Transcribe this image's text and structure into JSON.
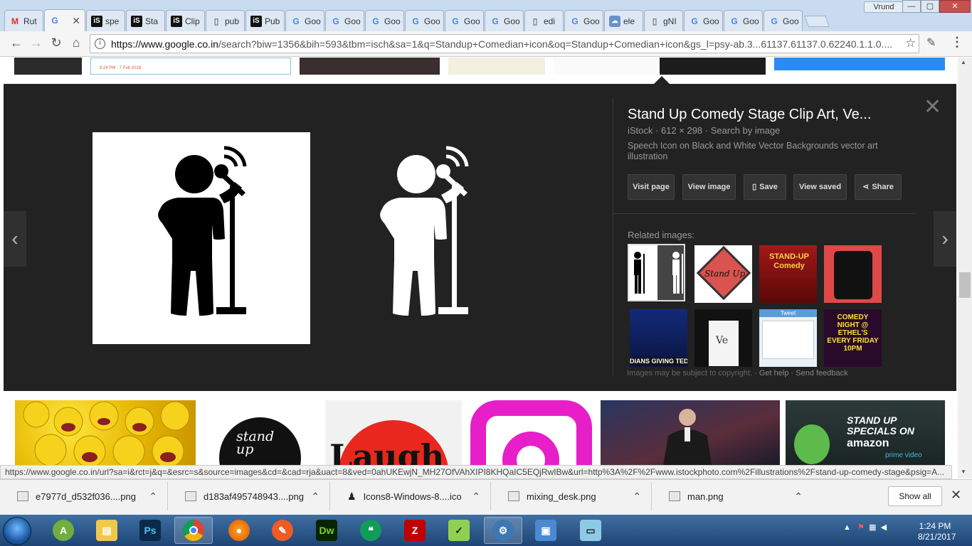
{
  "window": {
    "user_label": "Vrund",
    "minimize": "—",
    "maximize": "▢",
    "close": "✕"
  },
  "tabs": [
    {
      "icon": "gmail-icon",
      "label": "Rut"
    },
    {
      "icon": "google-icon",
      "label": "",
      "active": true
    },
    {
      "icon": "istock-icon",
      "label": "spe"
    },
    {
      "icon": "istock-icon",
      "label": "Sta"
    },
    {
      "icon": "istock-icon",
      "label": "Clip"
    },
    {
      "icon": "document-icon",
      "label": "pub"
    },
    {
      "icon": "istock-icon",
      "label": "Pub"
    },
    {
      "icon": "google-icon",
      "label": "Goo"
    },
    {
      "icon": "google-icon",
      "label": "Goo"
    },
    {
      "icon": "google-icon",
      "label": "Goo"
    },
    {
      "icon": "google-icon",
      "label": "Goo"
    },
    {
      "icon": "google-icon",
      "label": "Goo"
    },
    {
      "icon": "google-icon",
      "label": "Goo"
    },
    {
      "icon": "document-icon",
      "label": "edi"
    },
    {
      "icon": "google-icon",
      "label": "Goo"
    },
    {
      "icon": "extension-icon",
      "label": "ele"
    },
    {
      "icon": "document-icon",
      "label": "gNI"
    },
    {
      "icon": "google-icon",
      "label": "Goo"
    },
    {
      "icon": "google-icon",
      "label": "Goo"
    },
    {
      "icon": "google-icon",
      "label": "Goo"
    }
  ],
  "toolbar": {
    "url_host": "https://www.google.co.in",
    "url_path": "/search?biw=1356&bih=593&tbm=isch&sa=1&q=Standup+Comedian+icon&oq=Standup+Comedian+icon&gs_l=psy-ab.3...61137.61137.0.62240.1.1.0...."
  },
  "top_thumbs": {
    "thumb2_caption": "8:24 PM - 7 Feb 2016"
  },
  "panel": {
    "title": "Stand Up Comedy Stage Clip Art, Ve...",
    "source": "iStock",
    "size": "612 × 298",
    "search_by_image": "Search by image",
    "description": "Speech Icon on Black and White Vector Backgrounds vector art illustration",
    "buttons": {
      "visit_page": "Visit page",
      "view_image": "View image",
      "save": "Save",
      "view_saved": "View saved",
      "share": "Share"
    },
    "related_heading": "Related images:",
    "related_labels": {
      "r3": "STAND-UP Comedy",
      "r5": "DIANS GIVING TED",
      "r6": "Ve",
      "r7": "Tweet",
      "r8": "COMEDY NIGHT @ ETHEL'S EVERY FRIDAY 10PM",
      "r2": "Stand Up"
    },
    "copyright_note": "Images may be subject to copyright.",
    "get_help": "Get help",
    "send_feedback": "Send feedback",
    "close": "✕"
  },
  "results_row": {
    "b2_text": "stand up",
    "b3_text": "Laugh",
    "b6_line1": "STAND UP",
    "b6_line2": "SPECIALS ON",
    "b6_line3": "amazon",
    "b6_line4": "prime video"
  },
  "status_bar": "https://www.google.co.in/url?sa=i&rct=j&q=&esrc=s&source=images&cd=&cad=rja&uact=8&ved=0ahUKEwjN_MH27OfVAhXIPI8KHQaIC5EQjRwIBw&url=http%3A%2F%2Fwww.istockphoto.com%2Fillustrations%2Fstand-up-comedy-stage&psig=A...",
  "downloads": [
    {
      "name": "e7977d_d532f036....png"
    },
    {
      "name": "d183af495748943....png"
    },
    {
      "name": "Icons8-Windows-8....ico"
    },
    {
      "name": "mixing_desk.png"
    },
    {
      "name": "man.png"
    }
  ],
  "downloads_show_all": "Show all",
  "taskbar": {
    "time": "1:24 PM",
    "date": "8/21/2017",
    "apps": [
      "android-studio",
      "file-explorer",
      "photoshop",
      "chrome",
      "firefox",
      "postman",
      "dreamweaver",
      "hangouts",
      "filezilla",
      "notepad-plus",
      "control-panel",
      "photo-viewer",
      "notepad"
    ],
    "ps_label": "Ps",
    "dw_label": "Dw",
    "fz_label": "Z"
  },
  "colors": {
    "panel_bg": "#222222",
    "google_blue": "#4285f4",
    "taskbar_blue": "#1e4574"
  }
}
